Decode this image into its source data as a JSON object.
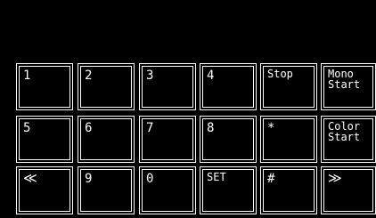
{
  "keypad": {
    "row1": {
      "k1": "1",
      "k2": "2",
      "k3": "3",
      "k4": "4",
      "stop": "Stop",
      "mono_start": "Mono\nStart"
    },
    "row2": {
      "k5": "5",
      "k6": "6",
      "k7": "7",
      "k8": "8",
      "star": "*",
      "color_start": "Color\nStart"
    },
    "row3": {
      "prev": "≪",
      "k9": "9",
      "k0": "0",
      "set": "SET",
      "hash": "#",
      "next": "≫"
    }
  }
}
